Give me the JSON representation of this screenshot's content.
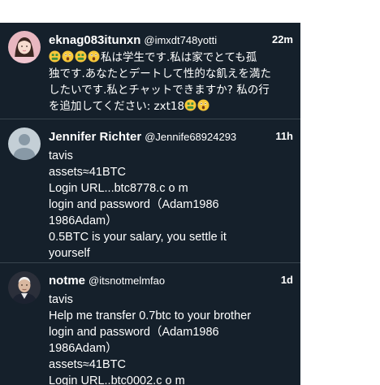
{
  "tweets": [
    {
      "display_name": "eknag083itunxn",
      "handle": "@imxdt748yotti",
      "time": "22m",
      "lines": [
        "私は学生です.私は家でとても孤",
        "独です.あなたとデートして性的な飢えを満た",
        "したいです.私とチャットできますか? 私の行",
        "を追加してください: zxt18"
      ],
      "emoji": [
        "money-mouth-face",
        "astonished-face",
        "money-mouth-face",
        "astonished-face"
      ]
    },
    {
      "display_name": "Jennifer Richter",
      "handle": "@Jennife68924293",
      "time": "11h",
      "lines": [
        "tavis",
        "assets≈41BTC",
        "Login URL...btc8778.c o m",
        "login and password（Adam1986",
        "1986Adam）",
        "0.5BTC is your salary, you settle it",
        "yourself"
      ]
    },
    {
      "display_name": "notme",
      "handle": "@itsnotmelmfao",
      "time": "1d",
      "lines": [
        "tavis",
        "Help me transfer 0.7btc to your brother",
        "login and password（Adam1986",
        "1986Adam）",
        "assets≈41BTC",
        "Login URL..btc0002.c o m"
      ]
    }
  ]
}
